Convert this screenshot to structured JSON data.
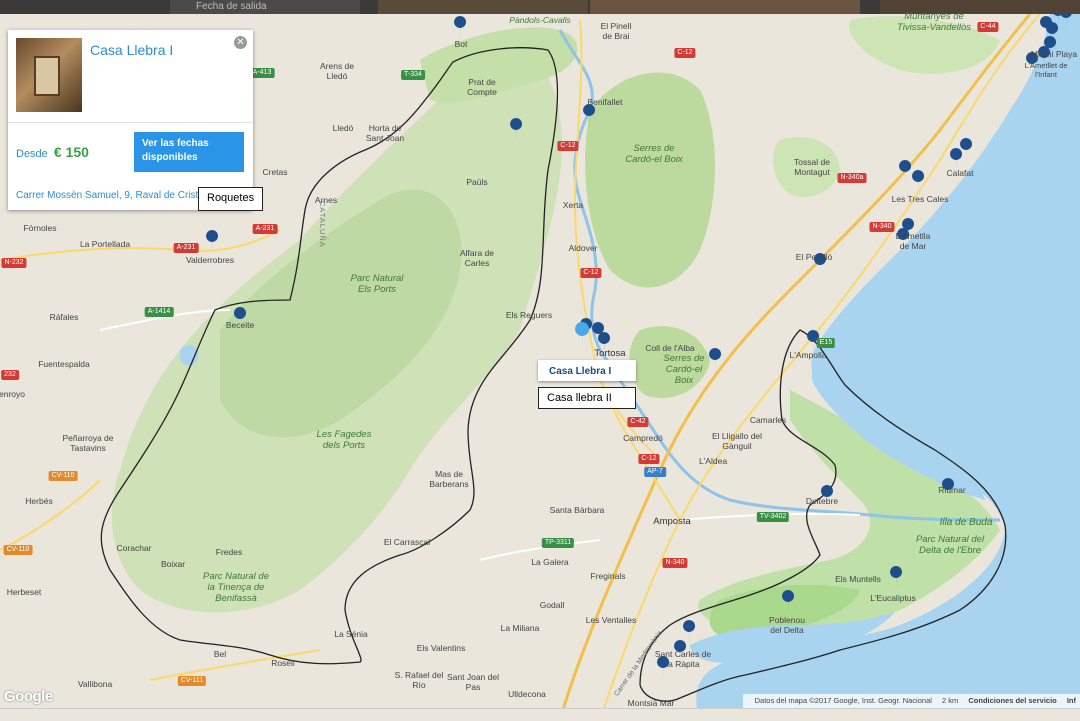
{
  "header": {
    "date_label": "Fecha de salida"
  },
  "listing": {
    "title": "Casa Llebra I",
    "price_prefix": "Desde",
    "price": "€ 150",
    "button_label": "Ver las fechas disponibles",
    "address": "Carrer Mossèn Samuel, 9, Raval de Cristo,"
  },
  "callouts": {
    "roquetes": "Roquetes",
    "casa_llebra_2": "Casa llebra II"
  },
  "tooltip": {
    "title": "Casa Llebra I"
  },
  "places": {
    "bot": "Bot",
    "pinell": "El Pinell de Brai",
    "pandols": "Pàndols-Cavalls",
    "arens": "Arens de Lledó",
    "prat": "Prat de Compte",
    "benifallet": "Benifallet",
    "lledo": "Lledó",
    "horta": "Horta de Sant Joan",
    "cretas": "Cretas",
    "pauls": "Paüls",
    "xerta": "Xerta",
    "arnes": "Arnes",
    "fornoles": "Fórnoles",
    "portellada": "La Portellada",
    "valderrobres": "Valderrobres",
    "alfara": "Alfara de Carles",
    "aldover": "Aldover",
    "beceite": "Beceite",
    "rafales": "Ráfales",
    "regueres": "Els Reguers",
    "tortosa": "Tortosa",
    "colldalba": "Coll de l'Alba",
    "fuentespalda": "Fuentespalda",
    "penarroya": "Peñarroya de Tastavins",
    "herbes": "Herbés",
    "campredo": "Campredó",
    "lligallo": "El Lligallo del Gànguil",
    "camarles": "Camarles",
    "aldea": "L'Aldea",
    "masdebarberans": "Mas de Barberans",
    "santabarbara": "Santa Bàrbara",
    "amposta": "Amposta",
    "fredes": "Fredes",
    "corachar": "Corachar",
    "boixar": "Boixar",
    "carrascal": "El Carrascal",
    "galera": "La Galera",
    "freginals": "Freginals",
    "godall": "Godall",
    "ventalles": "Les Ventalles",
    "senia": "La Sénia",
    "valentins": "Els Valentins",
    "miliana": "La Miliana",
    "bel": "Bel",
    "rosell": "Rosell",
    "srafael": "S. Rafael del Río",
    "santjoan": "Sant Joan del Pas",
    "ulldecona": "Ulldecona",
    "vallibona": "Vallibona",
    "montsia": "Montsià Mar",
    "santcarles": "Sant Carles de la Ràpita",
    "poblenou": "Poblenou del Delta",
    "muntells": "Els Muntells",
    "eucaliptus": "L'Eucaliptus",
    "deltebre": "Deltebre",
    "riumar": "Riumar",
    "illabuda": "Illa de Buda",
    "ampolla": "L'Ampolla",
    "perello": "El Perelló",
    "ametlla": "L'Ametlla de Mar",
    "trescales": "Les Tres Cales",
    "calafat": "Calafat",
    "tossal": "Tossal de Montagut",
    "miami": "Miami Playa",
    "ametllet": "L'Ametllet de l'Infant",
    "tivissa": "Muntanyes de Tivissa-Vandellòs",
    "serres1": "Serres de Cardó-el Boix",
    "serres2": "Serres de Cardó-el Boix",
    "herbeset": "Herbeset",
    "enroyo": "enroyo",
    "parcports": "Parc Natural Els Ports",
    "fagedes": "Les Fagedes dels Ports",
    "parctinenca": "Parc Natural de la Tinença de Benifassà",
    "parcdelta": "Parc Natural del Delta de l'Ebre",
    "cataluna": "CATALUÑA",
    "roadmed": "Carrer de la Mediterrània"
  },
  "roads": {
    "c12a": "C-12",
    "c12b": "C-12",
    "c12c": "C-12",
    "c12d": "C-12",
    "c42": "C-42",
    "ap7": "AP-7",
    "n340a": "N-340a",
    "n340b": "N-340",
    "n340c": "N-340",
    "tv3402": "TV-3402",
    "tp3311": "TP-3311",
    "a231a": "A-231",
    "a231b": "A-231",
    "a1414": "A-1414",
    "a413": "A-413",
    "n232a": "N-232",
    "n232b": "232",
    "cv110a": "CV-110",
    "cv110b": "CV-110",
    "cv111": "CV-111",
    "t334": "T-334",
    "c44": "C-44",
    "e15": "E15"
  },
  "attribution": {
    "data": "Datos del mapa ©2017 Google, Inst. Geogr. Nacional",
    "scale": "2 km",
    "terms": "Condiciones del servicio",
    "info": "Inf"
  },
  "logo": "Google",
  "colors": {
    "water": "#a8d4f0",
    "park": "#c4dfa8",
    "land": "#eae6dc",
    "pin": "#1f4e8c",
    "price": "#3aa142",
    "button": "#2a95e6"
  }
}
